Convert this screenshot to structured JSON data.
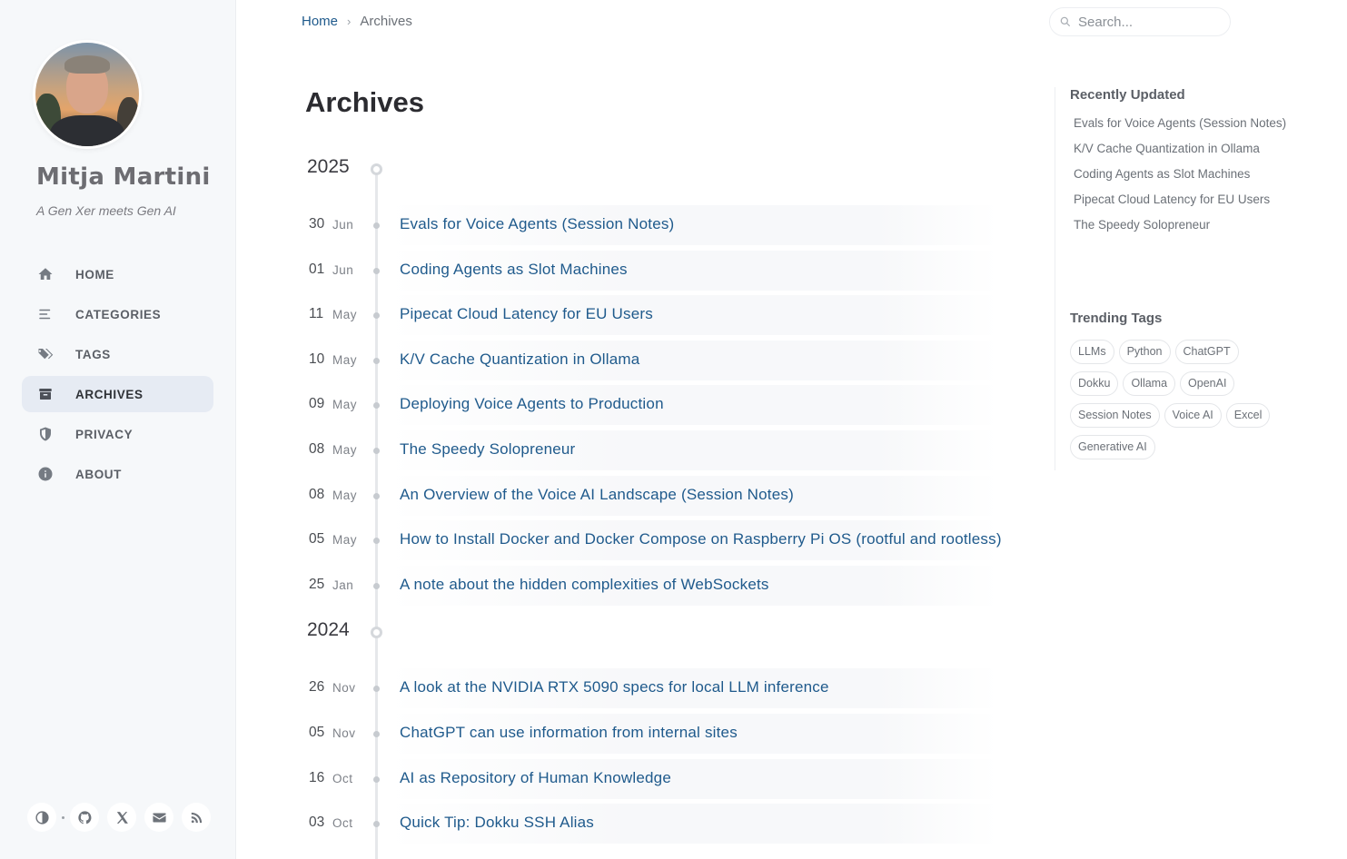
{
  "sidebar": {
    "site_title": "Mitja Martini",
    "site_subtitle": "A Gen Xer meets Gen AI",
    "nav": [
      {
        "label": "HOME",
        "icon": "home-icon"
      },
      {
        "label": "CATEGORIES",
        "icon": "list-icon"
      },
      {
        "label": "TAGS",
        "icon": "tags-icon"
      },
      {
        "label": "ARCHIVES",
        "icon": "archive-icon",
        "active": true
      },
      {
        "label": "PRIVACY",
        "icon": "shield-icon"
      },
      {
        "label": "ABOUT",
        "icon": "info-icon"
      }
    ],
    "bottom_icons": [
      "theme-toggle-icon",
      "github-icon",
      "x-icon",
      "email-icon",
      "rss-icon"
    ]
  },
  "topbar": {
    "breadcrumb_home": "Home",
    "breadcrumb_sep": "›",
    "breadcrumb_current": "Archives",
    "search_placeholder": "Search..."
  },
  "main": {
    "title": "Archives",
    "years": [
      {
        "year": "2025",
        "posts": [
          {
            "day": "30",
            "month": "Jun",
            "title": "Evals for Voice Agents (Session Notes)"
          },
          {
            "day": "01",
            "month": "Jun",
            "title": "Coding Agents as Slot Machines"
          },
          {
            "day": "11",
            "month": "May",
            "title": "Pipecat Cloud Latency for EU Users"
          },
          {
            "day": "10",
            "month": "May",
            "title": "K/V Cache Quantization in Ollama"
          },
          {
            "day": "09",
            "month": "May",
            "title": "Deploying Voice Agents to Production"
          },
          {
            "day": "08",
            "month": "May",
            "title": "The Speedy Solopreneur"
          },
          {
            "day": "08",
            "month": "May",
            "title": "An Overview of the Voice AI Landscape (Session Notes)"
          },
          {
            "day": "05",
            "month": "May",
            "title": "How to Install Docker and Docker Compose on Raspberry Pi OS (rootful and rootless)"
          },
          {
            "day": "25",
            "month": "Jan",
            "title": "A note about the hidden complexities of WebSockets"
          }
        ]
      },
      {
        "year": "2024",
        "posts": [
          {
            "day": "26",
            "month": "Nov",
            "title": "A look at the NVIDIA RTX 5090 specs for local LLM inference"
          },
          {
            "day": "05",
            "month": "Nov",
            "title": "ChatGPT can use information from internal sites"
          },
          {
            "day": "16",
            "month": "Oct",
            "title": "AI as Repository of Human Knowledge"
          },
          {
            "day": "03",
            "month": "Oct",
            "title": "Quick Tip: Dokku SSH Alias"
          }
        ]
      }
    ]
  },
  "panel": {
    "recent_heading": "Recently Updated",
    "recent": [
      "Evals for Voice Agents (Session Notes)",
      "K/V Cache Quantization in Ollama",
      "Coding Agents as Slot Machines",
      "Pipecat Cloud Latency for EU Users",
      "The Speedy Solopreneur"
    ],
    "tags_heading": "Trending Tags",
    "tags": [
      "LLMs",
      "Python",
      "ChatGPT",
      "Dokku",
      "Ollama",
      "OpenAI",
      "Session Notes",
      "Voice AI",
      "Excel",
      "Generative AI"
    ]
  },
  "colors": {
    "link": "#1f5a8c",
    "sidebar_bg": "#f6f8fa",
    "active_nav_bg": "#e6ebf3"
  }
}
